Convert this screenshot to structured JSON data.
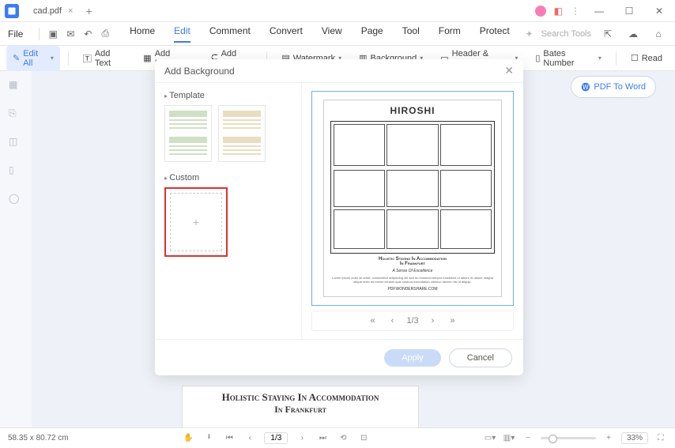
{
  "titlebar": {
    "tab_name": "cad.pdf"
  },
  "menubar": {
    "file": "File",
    "tabs": [
      "Home",
      "Edit",
      "Comment",
      "Convert",
      "View",
      "Page",
      "Tool",
      "Form",
      "Protect"
    ],
    "active_index": 1,
    "search_placeholder": "Search Tools"
  },
  "toolbar": {
    "edit_all": "Edit All",
    "add_text": "Add Text",
    "add_image": "Add Image",
    "add_link": "Add Link",
    "watermark": "Watermark",
    "background": "Background",
    "header_footer": "Header & Footer",
    "bates_number": "Bates Number",
    "read": "Read"
  },
  "side_button": {
    "pdf_to_word": "PDF To Word"
  },
  "modal": {
    "title": "Add Background",
    "template_label": "Template",
    "custom_label": "Custom",
    "preview": {
      "title": "HIROSHI",
      "subtitle1": "Holistic Staying In Accommodation",
      "subtitle2": "In Frankfurt",
      "tagline": "A Sense Of Excellence",
      "footer_link": "PDFWONDERSHARE.COM"
    },
    "pager": {
      "current": "1",
      "total": "/3"
    },
    "apply": "Apply",
    "cancel": "Cancel"
  },
  "bg_page": {
    "line1": "Holistic Staying In Accommodation",
    "line2": "In Frankfurt"
  },
  "statusbar": {
    "dims": "58.35 x 80.72 cm",
    "page": "1/3",
    "zoom": "33%"
  }
}
